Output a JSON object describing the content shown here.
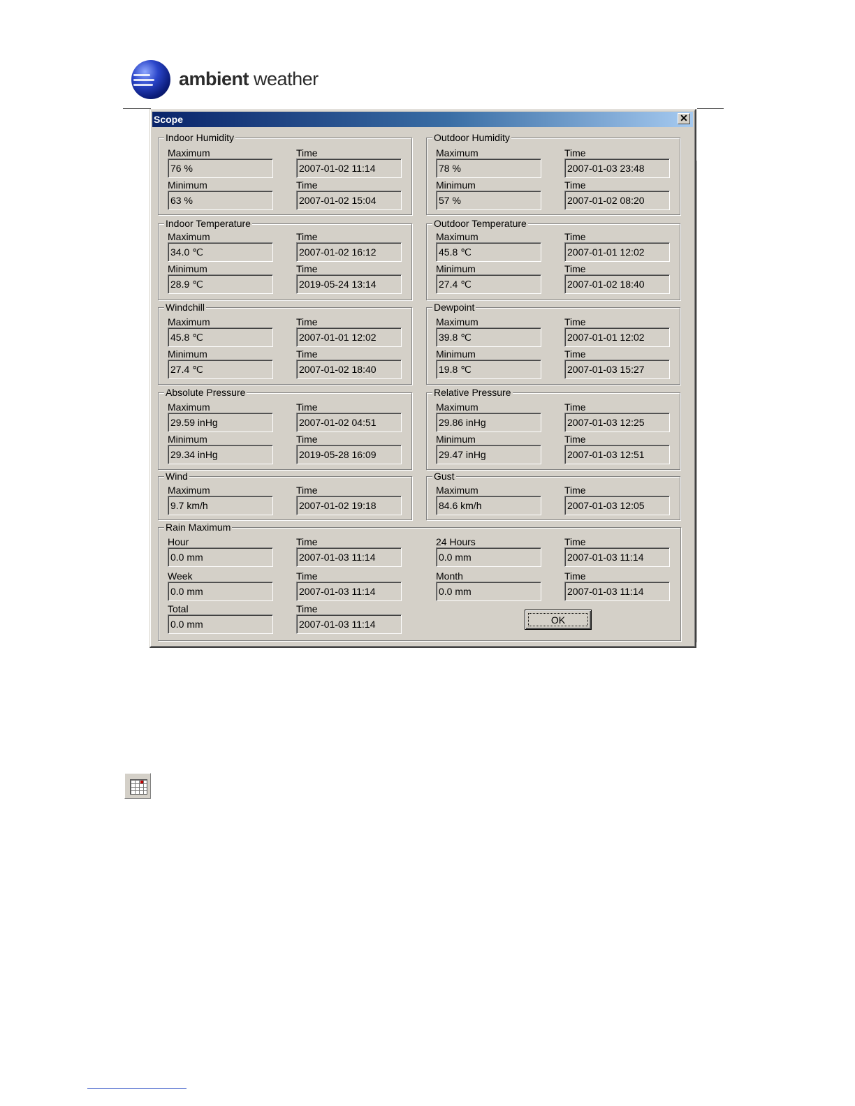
{
  "brand": {
    "name_bold": "ambient",
    "name_light": " weather"
  },
  "dialog": {
    "title": "Scope",
    "close_glyph": "✕",
    "ok_label": "OK"
  },
  "groups": {
    "indoor_humidity": {
      "title": "Indoor Humidity",
      "max_label": "Maximum",
      "min_label": "Minimum",
      "time_label": "Time",
      "max": "76 %",
      "max_time": "2007-01-02 11:14",
      "min": "63 %",
      "min_time": "2007-01-02 15:04"
    },
    "outdoor_humidity": {
      "title": "Outdoor Humidity",
      "max_label": "Maximum",
      "min_label": "Minimum",
      "time_label": "Time",
      "max": "78 %",
      "max_time": "2007-01-03 23:48",
      "min": "57 %",
      "min_time": "2007-01-02 08:20"
    },
    "indoor_temperature": {
      "title": "Indoor Temperature",
      "max_label": "Maximum",
      "min_label": "Minimum",
      "time_label": "Time",
      "max": "34.0 ℃",
      "max_time": "2007-01-02 16:12",
      "min": "28.9 ℃",
      "min_time": "2019-05-24 13:14"
    },
    "outdoor_temperature": {
      "title": "Outdoor Temperature",
      "max_label": "Maximum",
      "min_label": "Minimum",
      "time_label": "Time",
      "max": "45.8 ℃",
      "max_time": "2007-01-01 12:02",
      "min": "27.4 ℃",
      "min_time": "2007-01-02 18:40"
    },
    "windchill": {
      "title": "Windchill",
      "max_label": "Maximum",
      "min_label": "Minimum",
      "time_label": "Time",
      "max": "45.8 ℃",
      "max_time": "2007-01-01 12:02",
      "min": "27.4 ℃",
      "min_time": "2007-01-02 18:40"
    },
    "dewpoint": {
      "title": "Dewpoint",
      "max_label": "Maximum",
      "min_label": "Minimum",
      "time_label": "Time",
      "max": "39.8 ℃",
      "max_time": "2007-01-01 12:02",
      "min": "19.8 ℃",
      "min_time": "2007-01-03 15:27"
    },
    "absolute_pressure": {
      "title": "Absolute Pressure",
      "max_label": "Maximum",
      "min_label": "Minimum",
      "time_label": "Time",
      "max": "29.59 inHg",
      "max_time": "2007-01-02 04:51",
      "min": "29.34 inHg",
      "min_time": "2019-05-28 16:09"
    },
    "relative_pressure": {
      "title": "Relative Pressure",
      "max_label": "Maximum",
      "min_label": "Minimum",
      "time_label": "Time",
      "max": "29.86 inHg",
      "max_time": "2007-01-03 12:25",
      "min": "29.47 inHg",
      "min_time": "2007-01-03 12:51"
    },
    "wind": {
      "title": "Wind",
      "max_label": "Maximum",
      "time_label": "Time",
      "max": "9.7 km/h",
      "max_time": "2007-01-02 19:18"
    },
    "gust": {
      "title": "Gust",
      "max_label": "Maximum",
      "time_label": "Time",
      "max": "84.6 km/h",
      "max_time": "2007-01-03 12:05"
    }
  },
  "rain": {
    "title": "Rain Maximum",
    "time_label": "Time",
    "hour_label": "Hour",
    "hour": "0.0 mm",
    "hour_time": "2007-01-03 11:14",
    "day_label": "24 Hours",
    "day": "0.0 mm",
    "day_time": "2007-01-03 11:14",
    "week_label": "Week",
    "week": "0.0 mm",
    "week_time": "2007-01-03 11:14",
    "month_label": "Month",
    "month": "0.0 mm",
    "month_time": "2007-01-03 11:14",
    "total_label": "Total",
    "total": "0.0 mm",
    "total_time": "2007-01-03 11:14"
  },
  "colors": {
    "dialog_face": "#d4d0c8",
    "title_start": "#0a246a",
    "title_end": "#a6caf0"
  },
  "icons": {
    "toolbar_icon": "calendar-icon"
  }
}
